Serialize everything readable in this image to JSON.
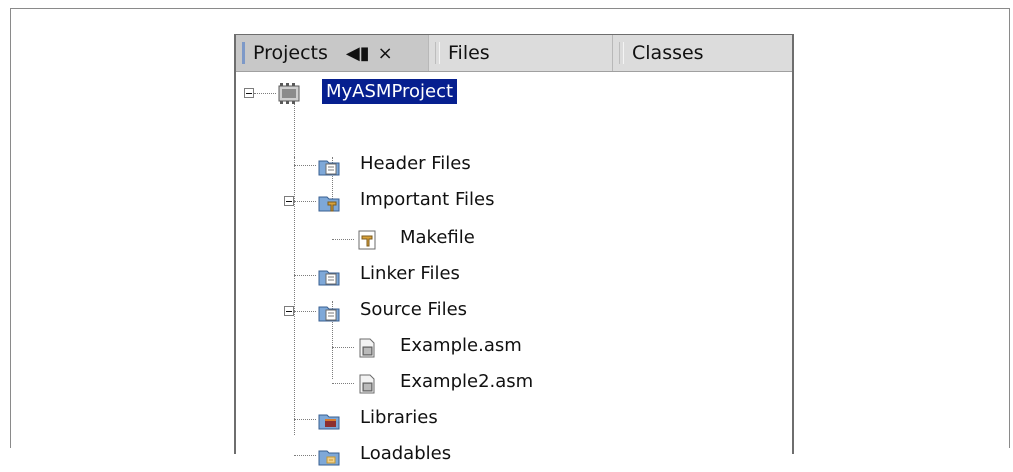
{
  "tabs": {
    "projects": "Projects",
    "files": "Files",
    "classes": "Classes",
    "close_label": "×",
    "speaker_label": "◀▮"
  },
  "tree": {
    "project": "MyASMProject",
    "header_files": "Header Files",
    "important_files": "Important Files",
    "makefile": "Makefile",
    "linker_files": "Linker Files",
    "source_files": "Source Files",
    "example_asm": "Example.asm",
    "example2_asm": "Example2.asm",
    "libraries": "Libraries",
    "loadables": "Loadables"
  }
}
